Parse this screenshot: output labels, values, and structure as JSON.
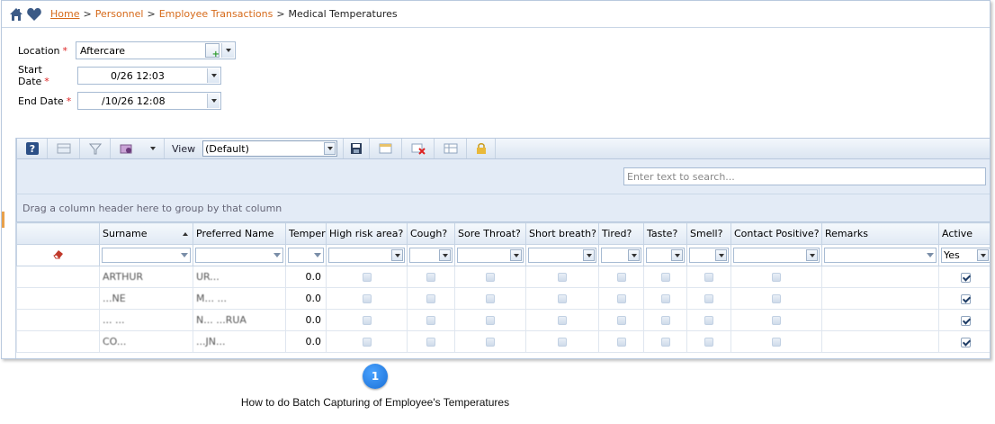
{
  "breadcrumb": {
    "home": "Home",
    "personnel": "Personnel",
    "employee_transactions": "Employee Transactions",
    "current": "Medical Temperatures",
    "separator": ">"
  },
  "form": {
    "location_label": "Location",
    "location_value": "Aftercare",
    "start_label": "Start Date",
    "start_value": "0/26 12:03",
    "end_label": "End Date",
    "end_value": "/10/26 12:08",
    "required_marker": "*"
  },
  "toolbar": {
    "view_label": "View",
    "view_value": "(Default)"
  },
  "search": {
    "placeholder": "Enter text to search..."
  },
  "group_hint": "Drag a column header here to group by that column",
  "columns": [
    "Surname",
    "Preferred Name",
    "Temperature",
    "High risk area?",
    "Cough?",
    "Sore Throat?",
    "Short breath?",
    "Tired?",
    "Taste?",
    "Smell?",
    "Contact Positive?",
    "Remarks",
    "Active"
  ],
  "filter": {
    "active_value": "Yes"
  },
  "rows": [
    {
      "surname": "ARTHUR",
      "preferred": "UR...",
      "temperature": "0.0",
      "active": true
    },
    {
      "surname": "...NE",
      "preferred": "M... ...",
      "temperature": "0.0",
      "active": true
    },
    {
      "surname": "... ...",
      "preferred": "N... ...RUA",
      "temperature": "0.0",
      "active": true
    },
    {
      "surname": "CO...",
      "preferred": "...JN...",
      "temperature": "0.0",
      "active": true
    }
  ],
  "step_badge": "1",
  "caption": "How to do Batch Capturing of Employee's Temperatures",
  "colors": {
    "link": "#d66a1a",
    "required": "#dd2222",
    "accent": "#1a6fd6"
  },
  "icons": [
    "home-icon",
    "heart-icon",
    "help-icon",
    "filter-icon",
    "save-icon",
    "lock-icon"
  ]
}
